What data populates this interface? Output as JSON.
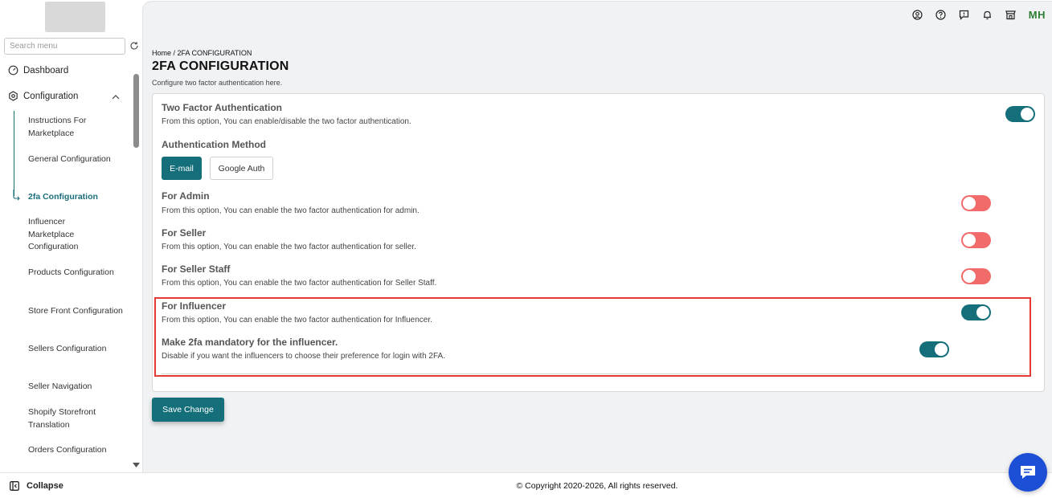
{
  "sidebar": {
    "search_placeholder": "Search menu",
    "dashboard": "Dashboard",
    "configuration": "Configuration",
    "sub_items": [
      {
        "label": "Instructions For Marketplace"
      },
      {
        "label": "General Configuration"
      },
      {
        "label": "2fa Configuration"
      },
      {
        "label": "Influencer Marketplace Configuration"
      },
      {
        "label": "Products Configuration"
      },
      {
        "label": "Store Front Configuration"
      },
      {
        "label": "Sellers Configuration"
      },
      {
        "label": "Seller Navigation"
      },
      {
        "label": "Shopify Storefront Translation"
      },
      {
        "label": "Orders Configuration"
      }
    ],
    "collapse_label": "Collapse"
  },
  "header": {
    "avatar_initials": "MH",
    "icons": [
      "user-circle-icon",
      "help-icon",
      "feedback-icon",
      "bell-icon",
      "store-icon"
    ]
  },
  "page": {
    "breadcrumb": "Home / 2FA CONFIGURATION",
    "title": "2FA CONFIGURATION",
    "subtitle": "Configure two factor authentication here."
  },
  "settings": {
    "two_factor": {
      "title": "Two Factor Authentication",
      "desc": "From this option, You can enable/disable the two factor authentication.",
      "enabled": true
    },
    "auth_method": {
      "title": "Authentication Method",
      "email_label": "E-mail",
      "google_label": "Google Auth",
      "selected": "E-mail"
    },
    "for_admin": {
      "title": "For Admin",
      "desc": "From this option, You can enable the two factor authentication for admin.",
      "enabled": false
    },
    "for_seller": {
      "title": "For Seller",
      "desc": "From this option, You can enable the two factor authentication for seller.",
      "enabled": false
    },
    "for_seller_staff": {
      "title": "For Seller Staff",
      "desc": "From this option, You can enable the two factor authentication for Seller Staff.",
      "enabled": false
    },
    "for_influencer": {
      "title": "For Influencer",
      "desc": "From this option, You can enable the two factor authentication for Influencer.",
      "enabled": true
    },
    "mandatory_influencer": {
      "title": "Make 2fa mandatory for the influencer.",
      "desc": "Disable if you want the influencers to choose their preference for login with 2FA.",
      "enabled": true
    }
  },
  "actions": {
    "save_label": "Save Change"
  },
  "footer": {
    "copyright": "© Copyright 2020-2026, All rights reserved."
  },
  "colors": {
    "primary": "#146f7a",
    "toggle_off": "#f26b6b",
    "highlight": "#e53935",
    "chat": "#1d4fd6"
  }
}
